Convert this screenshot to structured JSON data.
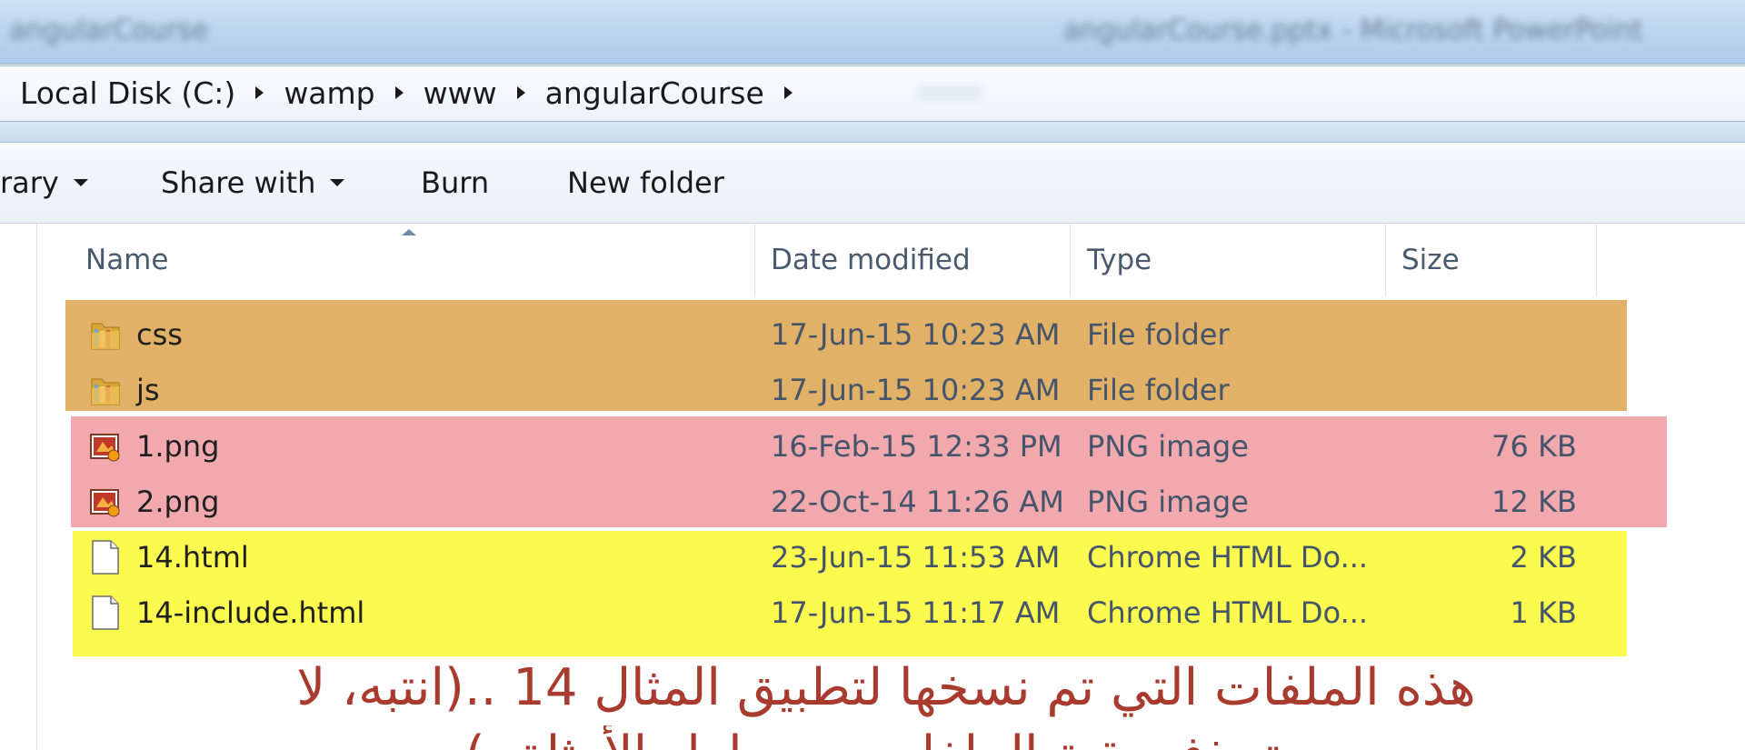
{
  "window": {
    "title_left": "angularCourse",
    "title_right": "angularCourse.pptx - Microsoft PowerPoint"
  },
  "address": {
    "crumbs": [
      "Local Disk (C:)",
      "wamp",
      "www",
      "angularCourse"
    ]
  },
  "toolbar": {
    "library_label": "rary",
    "share_label": "Share with",
    "burn_label": "Burn",
    "new_folder_label": "New folder"
  },
  "columns": {
    "name": "Name",
    "date": "Date modified",
    "type": "Type",
    "size": "Size"
  },
  "files": [
    {
      "name": "css",
      "date": "17-Jun-15 10:23 AM",
      "type": "File folder",
      "size": "",
      "icon": "folder-icon"
    },
    {
      "name": "js",
      "date": "17-Jun-15 10:23 AM",
      "type": "File folder",
      "size": "",
      "icon": "folder-icon"
    },
    {
      "name": "1.png",
      "date": "16-Feb-15 12:33 PM",
      "type": "PNG image",
      "size": "76 KB",
      "icon": "png-image-icon"
    },
    {
      "name": "2.png",
      "date": "22-Oct-14 11:26 AM",
      "type": "PNG image",
      "size": "12 KB",
      "icon": "png-image-icon"
    },
    {
      "name": "14.html",
      "date": "23-Jun-15 11:53 AM",
      "type": "Chrome HTML Do...",
      "size": "2 KB",
      "icon": "html-file-icon"
    },
    {
      "name": "14-include.html",
      "date": "17-Jun-15 11:17 AM",
      "type": "Chrome HTML Do...",
      "size": "1 KB",
      "icon": "html-file-icon"
    }
  ],
  "highlight_colors": {
    "folders": "#e2b168",
    "images": "#f2a9ad",
    "html": "#fbfa4f"
  },
  "annotation": {
    "line1": "هذه الملفات التي تم نسخها لتطبيق المثال 14 ..(انتبه، لا",
    "line2": "تحذف بقية الملفات من حلول الأمثلة..)"
  }
}
